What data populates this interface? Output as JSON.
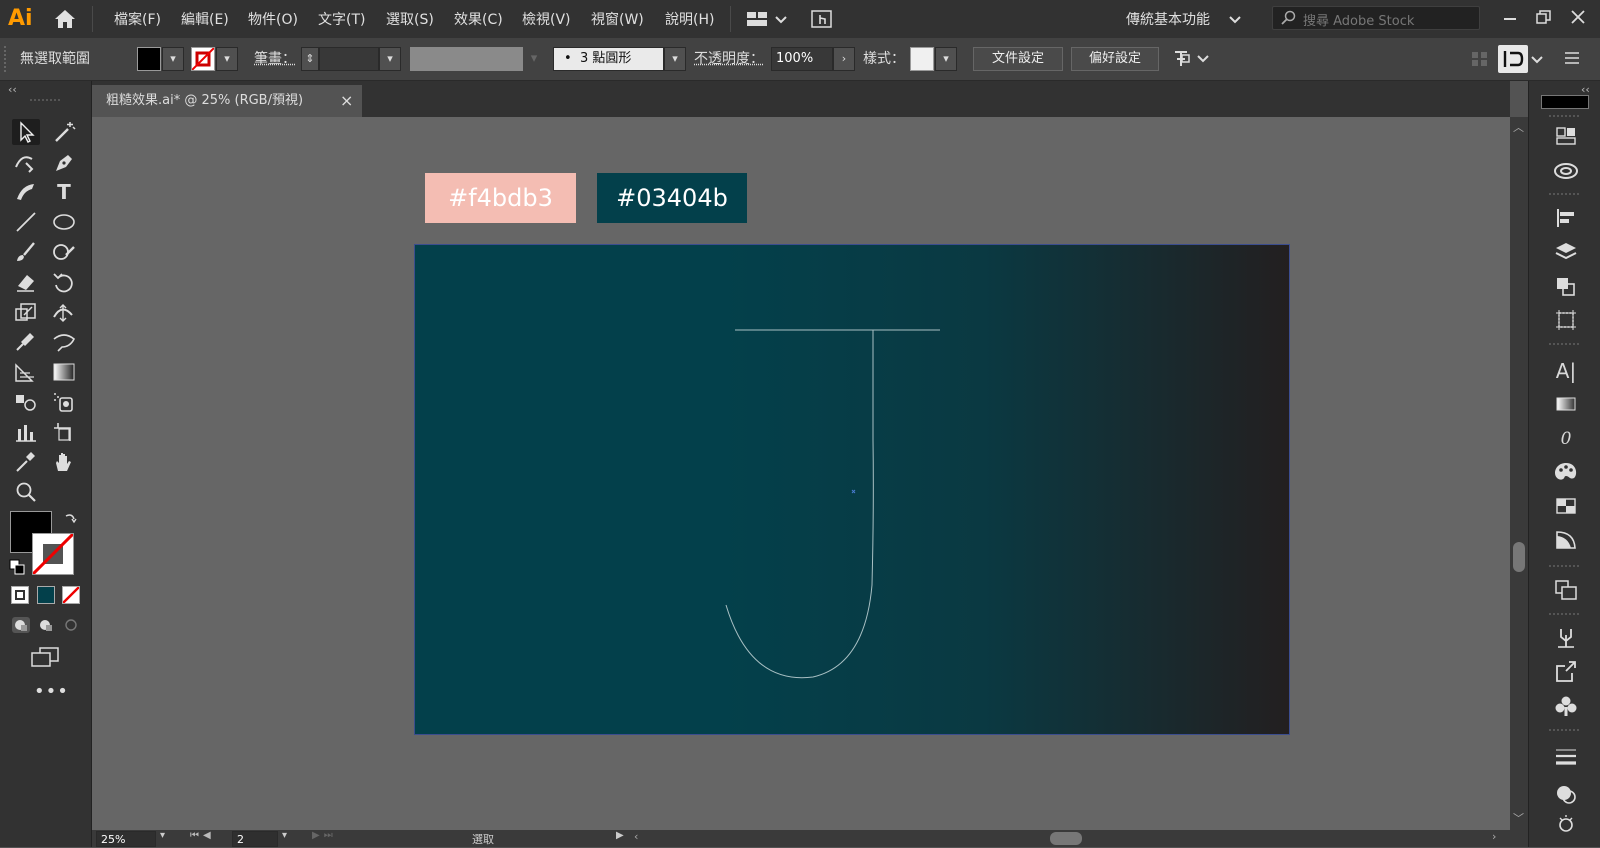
{
  "menubar": {
    "logo": "Ai",
    "items": [
      "檔案(F)",
      "編輯(E)",
      "物件(O)",
      "文字(T)",
      "選取(S)",
      "效果(C)",
      "檢視(V)",
      "視窗(W)",
      "說明(H)"
    ],
    "workspace": "傳統基本功能",
    "search_placeholder": "搜尋 Adobe Stock"
  },
  "controlbar": {
    "no_selection": "無選取範圍",
    "stroke_label": "筆畫：",
    "brush": "3 點圓形",
    "opacity_label": "不透明度：",
    "opacity_value": "100%",
    "style_label": "樣式：",
    "doc_setup": "文件設定",
    "preferences": "偏好設定"
  },
  "document": {
    "tab_title": "粗糙效果.ai* @ 25% (RGB/預視)",
    "close": "×"
  },
  "artwork": {
    "swatch1_label": "#f4bdb3",
    "swatch1_color": "#f4bdb3",
    "swatch2_label": "#03404b",
    "swatch2_color": "#03404b",
    "gradient_start": "#03404b",
    "gradient_end": "#231f20"
  },
  "status": {
    "zoom": "25%",
    "artboard": "2",
    "tool": "選取"
  },
  "colors": {
    "fill": "#000000",
    "stroke": "none",
    "accent": "#ff9a00"
  }
}
